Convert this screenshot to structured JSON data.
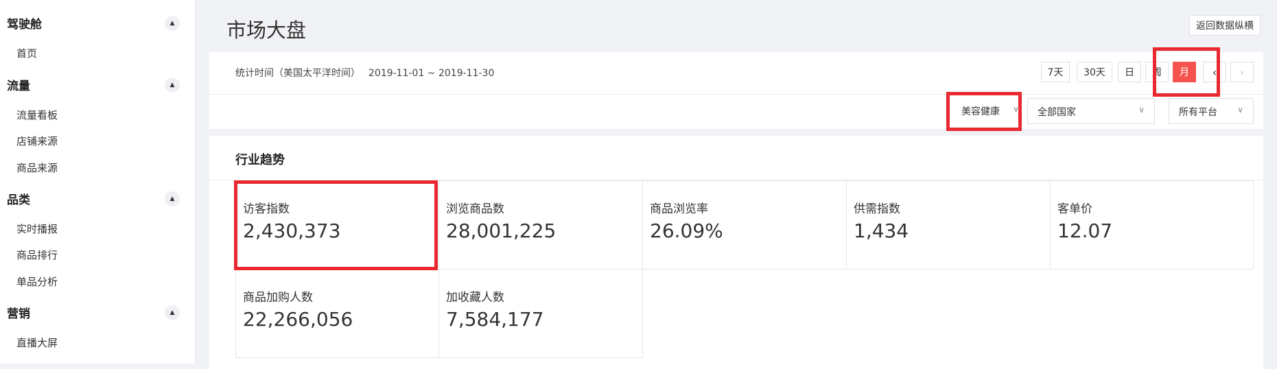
{
  "sidebar": {
    "sections": [
      {
        "title": "驾驶舱",
        "toggle": "▲",
        "items": [
          "首页"
        ]
      },
      {
        "title": "流量",
        "toggle": "▲",
        "items": [
          "流量看板",
          "店铺来源",
          "商品来源"
        ]
      },
      {
        "title": "品类",
        "toggle": "▲",
        "items": [
          "实时播报",
          "商品排行",
          "单品分析"
        ]
      },
      {
        "title": "营销",
        "toggle": "▲",
        "items": [
          "直播大屏"
        ]
      }
    ]
  },
  "header": {
    "title": "市场大盘",
    "return_button": "返回数据纵横"
  },
  "filters": {
    "stat_label": "统计时间（美国太平洋时间）",
    "date_range": "2019-11-01 ~ 2019-11-30",
    "periods": [
      {
        "label": "7天",
        "active": false
      },
      {
        "label": "30天",
        "active": false
      },
      {
        "label": "日",
        "active": false
      },
      {
        "label": "周",
        "active": false
      },
      {
        "label": "月",
        "active": true
      }
    ],
    "prev": "‹",
    "next": "›",
    "category": "美容健康",
    "country": "全部国家",
    "platform": "所有平台",
    "chevron": "∨"
  },
  "trends": {
    "title": "行业趋势",
    "metrics": [
      {
        "label": "访客指数",
        "value": "2,430,373"
      },
      {
        "label": "浏览商品数",
        "value": "28,001,225"
      },
      {
        "label": "商品浏览率",
        "value": "26.09%"
      },
      {
        "label": "供需指数",
        "value": "1,434"
      },
      {
        "label": "客单价",
        "value": "12.07"
      },
      {
        "label": "商品加购人数",
        "value": "22,266,056"
      },
      {
        "label": "加收藏人数",
        "value": "7,584,177"
      }
    ]
  },
  "colors": {
    "accent": "#f5544e",
    "highlight": "#e8292f"
  }
}
